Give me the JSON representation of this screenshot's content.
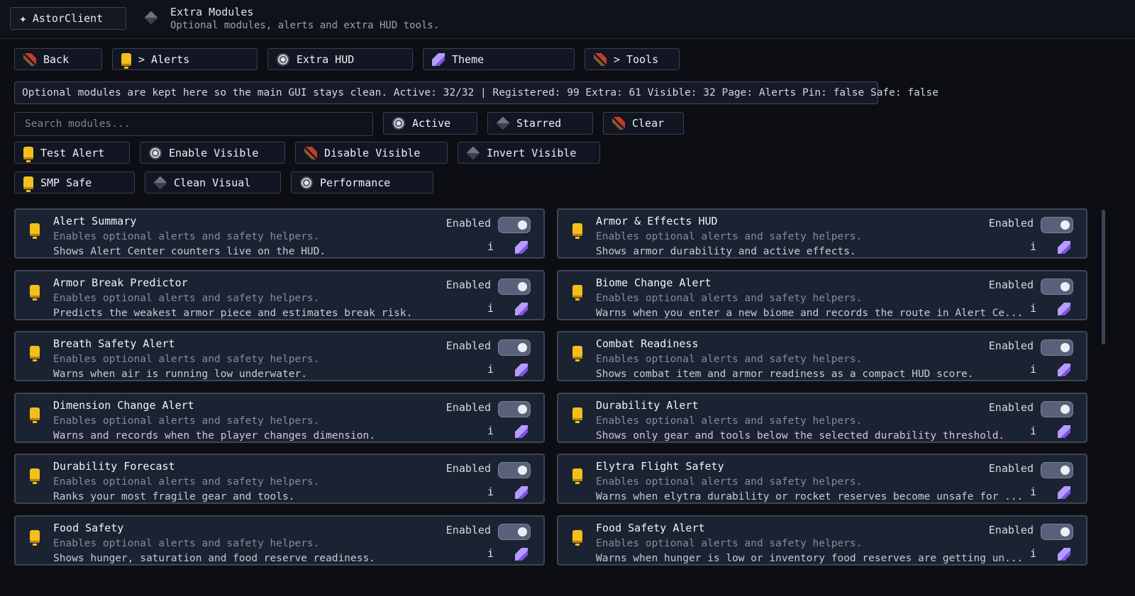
{
  "header": {
    "brand": "AstorClient",
    "title": "Extra Modules",
    "subtitle": "Optional modules, alerts and extra HUD tools."
  },
  "nav": {
    "back": "Back",
    "alerts": "> Alerts",
    "extra_hud": "Extra HUD",
    "theme": "Theme",
    "tools": "> Tools"
  },
  "info_bar": "Optional modules are kept here so the main GUI stays clean. Active: 32/32 | Registered: 99 Extra: 61 Visible: 32 Page: Alerts Pin: false Safe: false",
  "search": {
    "placeholder": "Search modules...",
    "value": ""
  },
  "filters": {
    "active": "Active",
    "starred": "Starred",
    "clear": "Clear"
  },
  "actions": {
    "test_alert": "Test Alert",
    "enable_visible": "Enable Visible",
    "disable_visible": "Disable Visible",
    "invert_visible": "Invert Visible"
  },
  "presets": {
    "smp_safe": "SMP Safe",
    "clean_visual": "Clean Visual",
    "performance": "Performance"
  },
  "modules": [
    {
      "name": "Alert Summary",
      "desc": "Enables optional alerts and safety helpers.",
      "detail": "Shows Alert Center counters live on the HUD.",
      "status": "Enabled",
      "info": "i"
    },
    {
      "name": "Armor & Effects HUD",
      "desc": "Enables optional alerts and safety helpers.",
      "detail": "Shows armor durability and active effects.",
      "status": "Enabled",
      "info": "i"
    },
    {
      "name": "Armor Break Predictor",
      "desc": "Enables optional alerts and safety helpers.",
      "detail": "Predicts the weakest armor piece and estimates break risk.",
      "status": "Enabled",
      "info": "i"
    },
    {
      "name": "Biome Change Alert",
      "desc": "Enables optional alerts and safety helpers.",
      "detail": "Warns when you enter a new biome and records the route in Alert Ce...",
      "status": "Enabled",
      "info": "i"
    },
    {
      "name": "Breath Safety Alert",
      "desc": "Enables optional alerts and safety helpers.",
      "detail": "Warns when air is running low underwater.",
      "status": "Enabled",
      "info": "i"
    },
    {
      "name": "Combat Readiness",
      "desc": "Enables optional alerts and safety helpers.",
      "detail": "Shows combat item and armor readiness as a compact HUD score.",
      "status": "Enabled",
      "info": "i"
    },
    {
      "name": "Dimension Change Alert",
      "desc": "Enables optional alerts and safety helpers.",
      "detail": "Warns and records when the player changes dimension.",
      "status": "Enabled",
      "info": "i"
    },
    {
      "name": "Durability Alert",
      "desc": "Enables optional alerts and safety helpers.",
      "detail": "Shows only gear and tools below the selected durability threshold.",
      "status": "Enabled",
      "info": "i"
    },
    {
      "name": "Durability Forecast",
      "desc": "Enables optional alerts and safety helpers.",
      "detail": "Ranks your most fragile gear and tools.",
      "status": "Enabled",
      "info": "i"
    },
    {
      "name": "Elytra Flight Safety",
      "desc": "Enables optional alerts and safety helpers.",
      "detail": "Warns when elytra durability or rocket reserves become unsafe for ...",
      "status": "Enabled",
      "info": "i"
    },
    {
      "name": "Food Safety",
      "desc": "Enables optional alerts and safety helpers.",
      "detail": "Shows hunger, saturation and food reserve readiness.",
      "status": "Enabled",
      "info": "i"
    },
    {
      "name": "Food Safety Alert",
      "desc": "Enables optional alerts and safety helpers.",
      "detail": "Warns when hunger is low or inventory food reserves are getting un...",
      "status": "Enabled",
      "info": "i"
    }
  ]
}
